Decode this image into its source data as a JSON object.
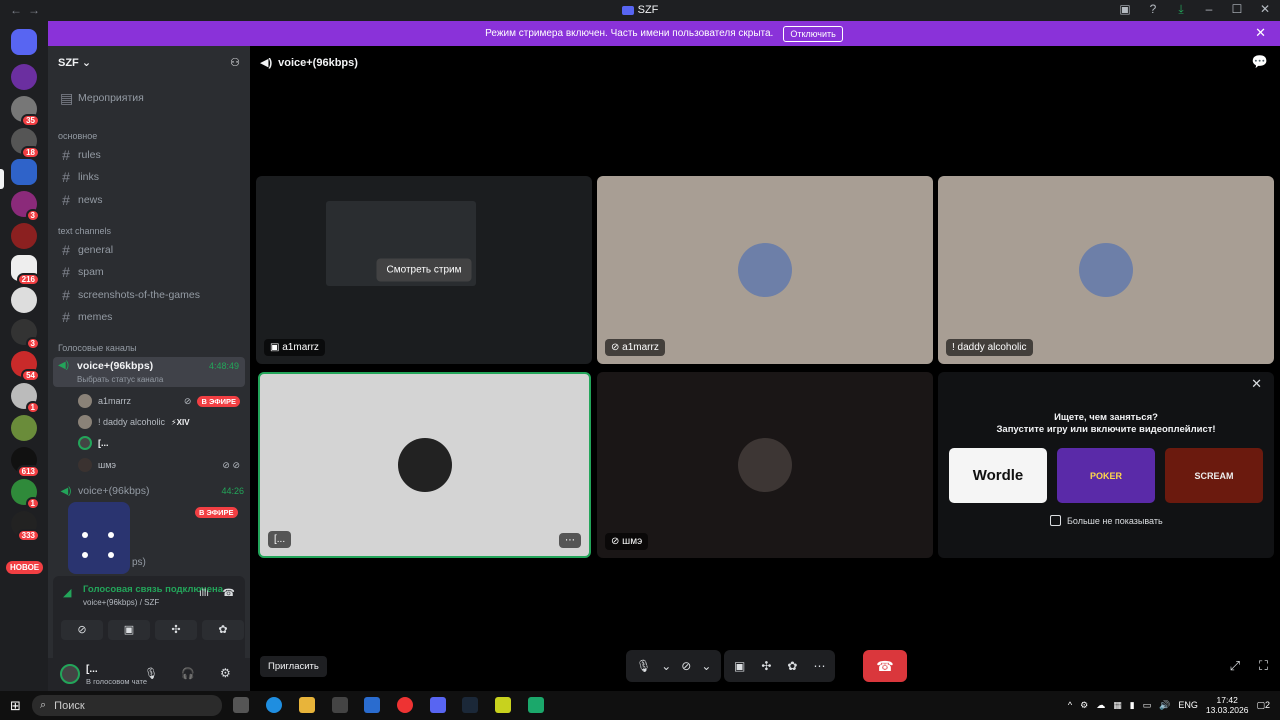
{
  "window": {
    "title": "SZF"
  },
  "banner": {
    "text": "Режим стримера включен. Часть имени пользователя скрыта.",
    "button": "Отключить"
  },
  "guilds": {
    "badges": [
      "35",
      "18",
      "3",
      "216",
      "3",
      "54",
      "1",
      "613",
      "1",
      "333"
    ],
    "new_label": "НОВОЕ"
  },
  "server": {
    "name": "SZF",
    "events": "Мероприятия",
    "categories": {
      "main": "основное",
      "text": "text channels",
      "voice": "Голосовые каналы"
    },
    "channels": [
      "rules",
      "links",
      "news",
      "general",
      "spam",
      "screenshots-of-the-games",
      "memes"
    ],
    "voice_channel": {
      "name": "voice+(96kbps)",
      "timer": "4:48:49",
      "status": "Выбрать статус канала"
    },
    "voice_users": [
      {
        "name": "a1marrz",
        "live": "В ЭФИРЕ"
      },
      {
        "name": "! daddy alcoholic",
        "tag": "XIV"
      },
      {
        "name": "[..."
      },
      {
        "name": "шмэ"
      }
    ],
    "voice_channel2": {
      "name": "voice+(96kbps)",
      "timer": "44:26",
      "live": "В ЭФИРЕ",
      "partial": "ps)"
    }
  },
  "panel": {
    "status": "Голосовая связь подключена",
    "sub": "voice+(96kbps) / SZF",
    "user": "[...",
    "user_status": "В голосовом чате"
  },
  "stage": {
    "header": "voice+(96kbps)",
    "watch_button": "Смотреть стрим",
    "tiles": [
      "a1marrz",
      "a1marrz",
      "! daddy alcoholic",
      "[...",
      "шмэ"
    ],
    "promo": {
      "title1": "Ищете, чем заняться?",
      "title2": "Запустите игру или включите видеоплейлист!",
      "games": [
        "Wordle",
        "POKER",
        "SCREAM"
      ],
      "dont_show": "Больше не показывать"
    },
    "invite": "Пригласить"
  },
  "taskbar": {
    "search": "Поиск",
    "lang": "ENG",
    "time": "17:42",
    "date": "13.03.2026",
    "notif": "2"
  },
  "colors": {
    "accent": "#5865f2",
    "banner": "#8a32d9",
    "live": "#f23f43",
    "online": "#23a55a"
  }
}
